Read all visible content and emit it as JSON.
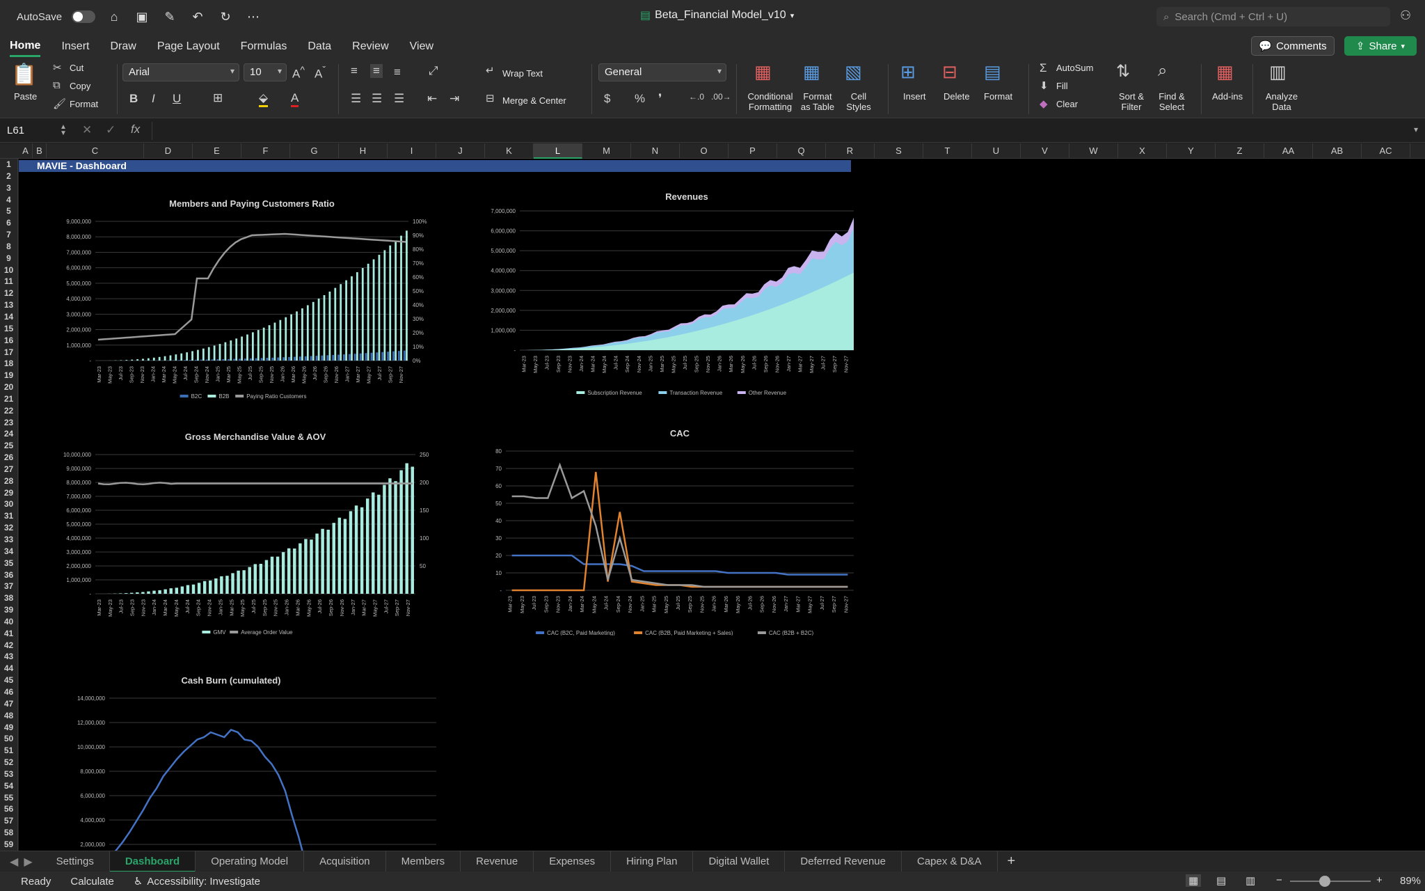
{
  "titlebar": {
    "autosave": "AutoSave",
    "doc_title": "Beta_Financial Model_v10",
    "search_placeholder": "Search (Cmd + Ctrl + U)"
  },
  "menu": [
    "Home",
    "Insert",
    "Draw",
    "Page Layout",
    "Formulas",
    "Data",
    "Review",
    "View"
  ],
  "buttons": {
    "comments": "Comments",
    "share": "Share"
  },
  "ribbon": {
    "paste": "Paste",
    "cut": "Cut",
    "copy": "Copy",
    "format": "Format",
    "font": "Arial",
    "size": "10",
    "wrap": "Wrap Text",
    "merge": "Merge & Center",
    "numfmt": "General",
    "cond": "Conditional Formatting",
    "fmt_table": "Format as Table",
    "cell_styles": "Cell Styles",
    "insert": "Insert",
    "delete": "Delete",
    "format2": "Format",
    "autosum": "AutoSum",
    "fill": "Fill",
    "clear": "Clear",
    "sort": "Sort & Filter",
    "find": "Find & Select",
    "addins": "Add-ins",
    "analyze": "Analyze Data"
  },
  "namebox": "L61",
  "columns": [
    "A",
    "B",
    "C",
    "D",
    "E",
    "F",
    "G",
    "H",
    "I",
    "J",
    "K",
    "L",
    "M",
    "N",
    "O",
    "P",
    "Q",
    "R",
    "S",
    "T",
    "U",
    "V",
    "W",
    "X",
    "Y",
    "Z",
    "AA",
    "AB",
    "AC"
  ],
  "banner": "MAVIE - Dashboard",
  "chart_data": [
    {
      "type": "bar",
      "title": "Members and Paying Customers Ratio",
      "ylim": [
        0,
        9000000
      ],
      "y2lim": [
        0,
        1
      ],
      "yticks": [
        "-",
        "1,000,000",
        "2,000,000",
        "3,000,000",
        "4,000,000",
        "5,000,000",
        "6,000,000",
        "7,000,000",
        "8,000,000",
        "9,000,000"
      ],
      "y2ticks": [
        "0%",
        "10%",
        "20%",
        "30%",
        "40%",
        "50%",
        "60%",
        "70%",
        "80%",
        "90%",
        "100%"
      ],
      "x_labels": [
        "Mar-23",
        "May-23",
        "Jul-23",
        "Sep-23",
        "Nov-23",
        "Jan-24",
        "Mar-24",
        "May-24",
        "Jul-24",
        "Sep-24",
        "Nov-24",
        "Jan-25",
        "Mar-25",
        "May-25",
        "Jul-25",
        "Sep-25",
        "Nov-25",
        "Jan-26",
        "Mar-26",
        "May-26",
        "Jul-26",
        "Sep-26",
        "Nov-26",
        "Jan-27",
        "Mar-27",
        "May-27",
        "Jul-27",
        "Sep-27",
        "Nov-27"
      ],
      "series": [
        {
          "name": "B2C",
          "color": "#3b6db5",
          "endpoints": [
            0,
            650000
          ]
        },
        {
          "name": "B2B",
          "color": "#a8ecdf",
          "endpoints": [
            0,
            8400000
          ]
        },
        {
          "name": "Paying Ratio Customers",
          "color": "#9a9a9a",
          "endpoints": [
            0.15,
            0.85
          ]
        }
      ]
    },
    {
      "type": "area",
      "title": "Revenues",
      "ylim": [
        0,
        7000000
      ],
      "yticks": [
        "-",
        "1,000,000",
        "2,000,000",
        "3,000,000",
        "4,000,000",
        "5,000,000",
        "6,000,000",
        "7,000,000"
      ],
      "x_labels": [
        "Mar-23",
        "May-23",
        "Jul-23",
        "Sep-23",
        "Nov-23",
        "Jan-24",
        "Mar-24",
        "May-24",
        "Jul-24",
        "Sep-24",
        "Nov-24",
        "Jan-25",
        "Mar-25",
        "May-25",
        "Jul-25",
        "Sep-25",
        "Nov-25",
        "Jan-26",
        "Mar-26",
        "May-26",
        "Jul-26",
        "Sep-26",
        "Nov-26",
        "Jan-27",
        "Mar-27",
        "May-27",
        "Jul-27",
        "Sep-27",
        "Nov-27"
      ],
      "series": [
        {
          "name": "Subscription Revenue",
          "color": "#a8ecdf",
          "end": 3900000
        },
        {
          "name": "Transaction Revenue",
          "color": "#8ccfea",
          "end": 5900000
        },
        {
          "name": "Other Revenue",
          "color": "#c9b4f0",
          "end": 6400000
        }
      ]
    },
    {
      "type": "bar",
      "title": "Gross Merchandise Value & AOV",
      "ylim": [
        0,
        10000000
      ],
      "y2lim": [
        0,
        250
      ],
      "yticks": [
        "-",
        "1,000,000",
        "2,000,000",
        "3,000,000",
        "4,000,000",
        "5,000,000",
        "6,000,000",
        "7,000,000",
        "8,000,000",
        "9,000,000",
        "10,000,000"
      ],
      "y2ticks": [
        "",
        "50",
        "100",
        "150",
        "200",
        "250"
      ],
      "x_labels": [
        "Mar-23",
        "May-23",
        "Jul-23",
        "Sep-23",
        "Nov-23",
        "Jan-24",
        "Mar-24",
        "May-24",
        "Jul-24",
        "Sep-24",
        "Nov-24",
        "Jan-25",
        "Mar-25",
        "May-25",
        "Jul-25",
        "Sep-25",
        "Nov-25",
        "Jan-26",
        "Mar-26",
        "May-26",
        "Jul-26",
        "Sep-26",
        "Nov-26",
        "Jan-27",
        "Mar-27",
        "May-27",
        "Jul-27",
        "Sep-27",
        "Nov-27"
      ],
      "series": [
        {
          "name": "GMV",
          "color": "#a8ecdf",
          "end": 9500000
        },
        {
          "name": "Average Order Value",
          "color": "#9a9a9a",
          "value": 198
        }
      ]
    },
    {
      "type": "line",
      "title": "CAC",
      "ylim": [
        0,
        80
      ],
      "yticks": [
        "-",
        "10",
        "20",
        "30",
        "40",
        "50",
        "60",
        "70",
        "80"
      ],
      "x_labels": [
        "Mar-23",
        "May-23",
        "Jul-23",
        "Sep-23",
        "Nov-23",
        "Jan-24",
        "Mar-24",
        "May-24",
        "Jul-24",
        "Sep-24",
        "Nov-24",
        "Jan-25",
        "Mar-25",
        "May-25",
        "Jul-25",
        "Sep-25",
        "Nov-25",
        "Jan-26",
        "Mar-26",
        "May-26",
        "Jul-26",
        "Sep-26",
        "Nov-26",
        "Jan-27",
        "Mar-27",
        "May-27",
        "Jul-27",
        "Sep-27",
        "Nov-27"
      ],
      "series": [
        {
          "name": "CAC (B2C, Paid Marketing)",
          "color": "#4472c4",
          "values": [
            20,
            20,
            20,
            20,
            20,
            20,
            15,
            15,
            15,
            15,
            14,
            11,
            11,
            11,
            11,
            11,
            11,
            11,
            10,
            10,
            10,
            10,
            10,
            9,
            9,
            9,
            9,
            9,
            9
          ]
        },
        {
          "name": "CAC (B2B, Paid Marketing + Sales)",
          "color": "#e0822e",
          "values": [
            0,
            0,
            0,
            0,
            0,
            0,
            0,
            68,
            5,
            45,
            5,
            4,
            3,
            3,
            3,
            2,
            2,
            2,
            2,
            2,
            2,
            2,
            2,
            2,
            2,
            2,
            2,
            2,
            2
          ]
        },
        {
          "name": "CAC (B2B + B2C)",
          "color": "#9a9a9a",
          "values": [
            54,
            54,
            53,
            53,
            72,
            53,
            57,
            37,
            6,
            30,
            6,
            5,
            4,
            3,
            3,
            3,
            2,
            2,
            2,
            2,
            2,
            2,
            2,
            2,
            2,
            2,
            2,
            2,
            2
          ]
        }
      ]
    },
    {
      "type": "line",
      "title": "Cash Burn (cumulated)",
      "ylim": [
        0,
        14000000
      ],
      "yticks": [
        "2,000,000",
        "4,000,000",
        "6,000,000",
        "8,000,000",
        "10,000,000",
        "12,000,000",
        "14,000,000"
      ],
      "series": [
        {
          "name": "Cash Burn",
          "color": "#4472c4",
          "values": [
            1000000,
            1500000,
            2200000,
            3000000,
            3900000,
            4800000,
            5800000,
            6600000,
            7600000,
            8300000,
            9000000,
            9600000,
            10100000,
            10600000,
            10800000,
            11200000,
            11000000,
            10800000,
            11400000,
            11200000,
            10600000,
            10500000,
            10000000,
            9200000,
            8600000,
            7700000,
            6400000,
            4400000,
            2600000,
            500000
          ]
        }
      ]
    }
  ],
  "sheet_tabs": [
    "Settings",
    "Dashboard",
    "Operating Model",
    "Acquisition",
    "Members",
    "Revenue",
    "Expenses",
    "Hiring Plan",
    "Digital Wallet",
    "Deferred Revenue",
    "Capex & D&A"
  ],
  "status": {
    "ready": "Ready",
    "calc": "Calculate",
    "access": "Accessibility: Investigate",
    "zoom": "89%"
  }
}
